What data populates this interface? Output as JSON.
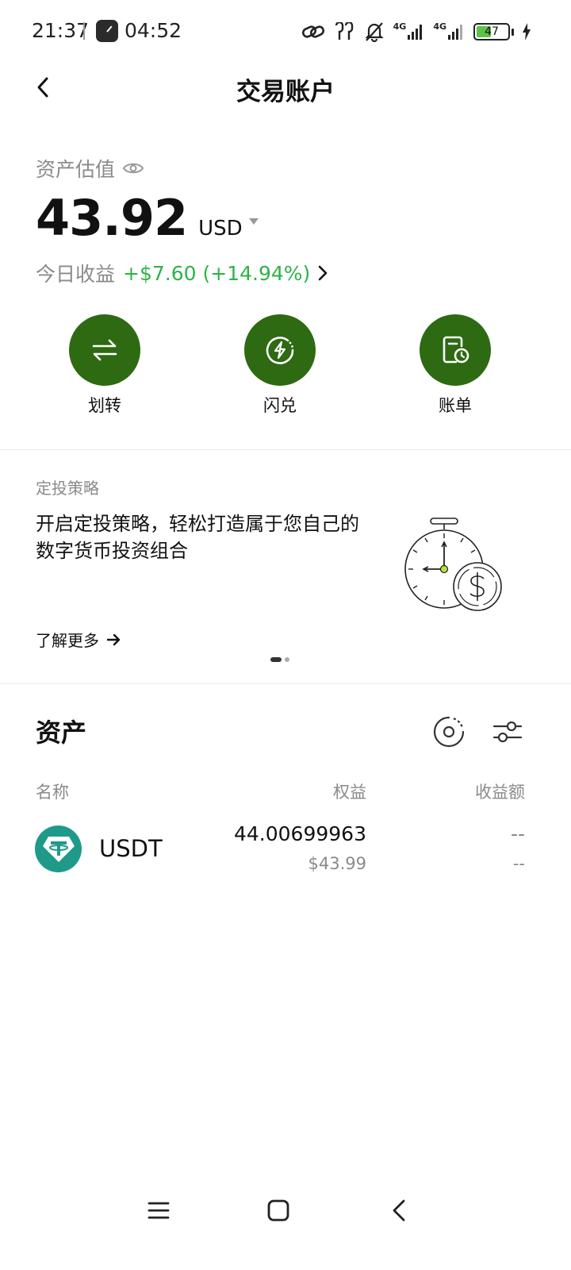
{
  "status_bar": {
    "time": "21:37",
    "secondary_time": "04:52",
    "network_1": "4G",
    "network_2": "4G",
    "battery_level": "47",
    "battery_percent": 47,
    "icons": [
      "link-icon",
      "earbuds-icon",
      "mute-icon",
      "signal-icon",
      "signal-icon",
      "battery-icon",
      "charging-icon"
    ]
  },
  "nav": {
    "title": "交易账户",
    "back_icon": "chevron-left-icon"
  },
  "valuation": {
    "label": "资产估值",
    "amount": "43.92",
    "currency": "USD",
    "today_label": "今日收益",
    "today_value": "+$7.60 (+14.94%)"
  },
  "actions": [
    {
      "label": "划转",
      "icon": "transfer-icon"
    },
    {
      "label": "闪兑",
      "icon": "flash-convert-icon"
    },
    {
      "label": "账单",
      "icon": "bill-icon"
    }
  ],
  "banner": {
    "tag": "定投策略",
    "text": "开启定投策略，轻松打造属于您自己的数字货币投资组合",
    "more_label": "了解更多",
    "page_count": 2,
    "active_page": 1
  },
  "assets": {
    "title": "资产",
    "columns": {
      "name": "名称",
      "equity": "权益",
      "profit": "收益额"
    },
    "rows": [
      {
        "coin": "USDT",
        "equity": "44.00699963",
        "equity_usd": "$43.99",
        "profit": "--",
        "profit_sub": "--"
      }
    ]
  },
  "colors": {
    "accent": "#2d6a12",
    "positive": "#2eb34a",
    "muted": "#8a8a8a",
    "usdt": "#1f9a8a"
  }
}
